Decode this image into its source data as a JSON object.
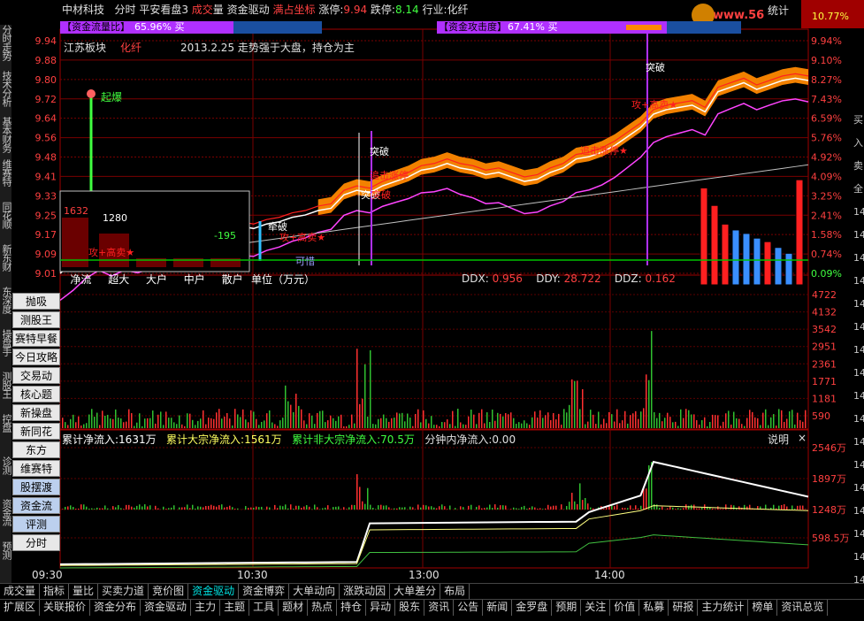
{
  "header": {
    "stock_name": "中材科技",
    "tabs": [
      "分时",
      "平安看盘3",
      "成交",
      "量",
      "资金驱动",
      "满占坐标"
    ],
    "limit_up_label": "涨停:",
    "limit_up": "9.94",
    "limit_down_label": "跌停:",
    "limit_down": "8.14",
    "industry": "行业:化纤",
    "stats_label": "统计",
    "watermark": "www.56",
    "watermark2": "10.77%"
  },
  "bars": {
    "flow_ratio_label": "【资金流量比】",
    "flow_ratio_value": "65.96% 买",
    "attack_label": "【资金攻击度】",
    "attack_value": "67.41% 买"
  },
  "annotation": {
    "sector": "江苏板块",
    "industry": "化纤",
    "note": "2013.2.25 走势强于大盘，持仓为主"
  },
  "markers": [
    "起爆",
    "突破",
    "牵破",
    "突破",
    "攻+高卖★",
    "攻+高卖★",
    "攻+高卖★",
    "攻+高卖★",
    "追击涨停",
    "追击涨停★",
    "突破",
    "高卖★",
    "突破",
    "突破",
    "可惜",
    "涨停",
    "突破"
  ],
  "inset": {
    "value1": "1632",
    "value2": "1280",
    "value3": "-195",
    "labels": [
      "净流",
      "超大",
      "大户",
      "中户",
      "散户"
    ],
    "unit": "单位（万元）"
  },
  "dd_stats": {
    "ddx_label": "DDX:",
    "ddx": "0.956",
    "ddy_label": "DDY:",
    "ddy": "28.722",
    "ddz_label": "DDZ:",
    "ddz": "0.162"
  },
  "flow_line": {
    "cum_net": "累计净流入:1631万",
    "cum_big": "累计大宗净流入:1561万",
    "cum_nonbig": "累计非大宗净流入:70.5万",
    "minute_net": "分钟内净流入:0.00",
    "explain": "说明",
    "close": "×"
  },
  "left_buttons": [
    "抛吸",
    "测股王",
    "赛特早餐",
    "今日攻略",
    "交易动",
    "核心题",
    "新操盘",
    "新同花",
    "东方",
    "维赛特",
    "股摆渡",
    "资金流",
    "评测",
    "分时MACD"
  ],
  "left_vertical_tabs": [
    "分时走势",
    "技术分析",
    "基本财务",
    "维赛特",
    "同花顺",
    "新东财",
    "东深度",
    "操盘手",
    "测股王",
    "控盘",
    "诊测",
    "资金流",
    "预测"
  ],
  "right_tabs": [
    "买",
    "入",
    "卖",
    "全",
    "14",
    "14",
    "14",
    "14",
    "14",
    "14",
    "14",
    "14",
    "14",
    "14",
    "14",
    "14",
    "14",
    "14",
    "14",
    "14",
    "14"
  ],
  "bottom_tabs_1": [
    "成交量",
    "指标",
    "量比",
    "买卖力道",
    "竞价图",
    "资金驱动",
    "资金博弈",
    "大单动向",
    "涨跌动因",
    "大单差分",
    "布局"
  ],
  "bottom_tabs_2": [
    "扩展区",
    "关联报价",
    "资金分布",
    "资金驱动",
    "主力",
    "主题",
    "工具",
    "题材",
    "热点",
    "持仓",
    "异动",
    "股东",
    "资讯",
    "公告",
    "新闻",
    "金罗盘",
    "预期",
    "关注",
    "价值",
    "私募",
    "研报",
    "主力统计",
    "榜单",
    "资讯总览"
  ],
  "chart_data": {
    "type": "line",
    "title": "",
    "xlabel": "",
    "ylabel": "",
    "x_ticks": [
      "09:30",
      "10:30",
      "13:00",
      "14:00"
    ],
    "price_ticks": [
      "9.94",
      "9.88",
      "9.80",
      "9.72",
      "9.64",
      "9.56",
      "9.48",
      "9.41",
      "9.33",
      "9.25",
      "9.17",
      "9.09",
      "9.01"
    ],
    "pct_ticks": [
      "9.94%",
      "9.10%",
      "8.27%",
      "7.43%",
      "6.59%",
      "5.76%",
      "4.92%",
      "4.09%",
      "3.25%",
      "2.41%",
      "1.58%",
      "0.74%",
      "0.09%"
    ],
    "ylim": [
      9.01,
      10.0
    ],
    "volume_ticks": [
      "4722",
      "4132",
      "3542",
      "2951",
      "2361",
      "1771",
      "1181",
      "590"
    ],
    "flow_ticks": [
      "2546万",
      "1897万",
      "1248万",
      "598.5万"
    ],
    "colors": {
      "price": "#ffffff",
      "avg": "#ffff00",
      "pink": "#ff44ff",
      "band": "#ff8800",
      "up": "#ff3030",
      "down": "#30c030",
      "blue": "#3a8fff"
    },
    "price_series": [
      9.01,
      9.06,
      9.12,
      9.16,
      9.14,
      9.17,
      9.16,
      9.18,
      9.21,
      9.2,
      9.18,
      9.17,
      9.19,
      9.2,
      9.22,
      9.21,
      9.23,
      9.24,
      9.26,
      9.27,
      9.29,
      9.3,
      9.36,
      9.38,
      9.37,
      9.4,
      9.42,
      9.44,
      9.47,
      9.48,
      9.5,
      9.48,
      9.47,
      9.45,
      9.46,
      9.44,
      9.42,
      9.43,
      9.46,
      9.48,
      9.52,
      9.53,
      9.55,
      9.58,
      9.62,
      9.66,
      9.72,
      9.74,
      9.75,
      9.76,
      9.73,
      9.82,
      9.84,
      9.86,
      9.83,
      9.85,
      9.87,
      9.88,
      9.87
    ],
    "side_bars": [
      {
        "v": 0.83,
        "c": "red"
      },
      {
        "v": 0.68,
        "c": "red"
      },
      {
        "v": 0.52,
        "c": "red"
      },
      {
        "v": 0.47,
        "c": "blue"
      },
      {
        "v": 0.44,
        "c": "blue"
      },
      {
        "v": 0.4,
        "c": "blue"
      },
      {
        "v": 0.37,
        "c": "red"
      },
      {
        "v": 0.32,
        "c": "blue"
      },
      {
        "v": 0.27,
        "c": "blue"
      },
      {
        "v": 0.9,
        "c": "red"
      }
    ]
  }
}
